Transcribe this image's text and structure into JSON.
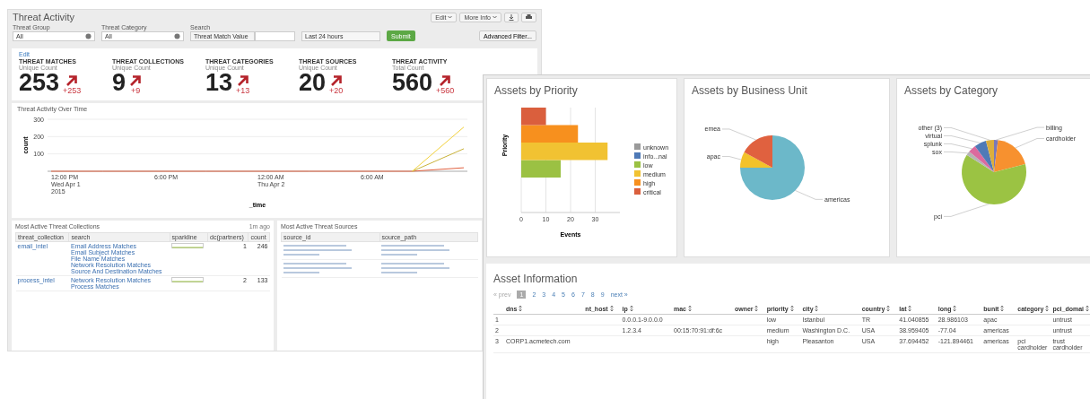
{
  "back_window": {
    "title": "Threat Activity",
    "header_buttons": [
      "Edit",
      "More Info"
    ],
    "filters": [
      {
        "label": "Threat Group",
        "value": "All"
      },
      {
        "label": "Threat Category",
        "value": "All"
      }
    ],
    "search": {
      "label": "Search",
      "field_type": "Threat Match Value"
    },
    "time_range": "Last 24 hours",
    "submit": "Submit",
    "advanced": "Advanced Filter...",
    "kpi_edit": "Edit",
    "kpis": [
      {
        "title": "THREAT MATCHES",
        "subtitle": "Unique Count",
        "value": "253",
        "delta": "+253"
      },
      {
        "title": "THREAT COLLECTIONS",
        "subtitle": "Unique Count",
        "value": "9",
        "delta": "+9"
      },
      {
        "title": "THREAT CATEGORIES",
        "subtitle": "Unique Count",
        "value": "13",
        "delta": "+13"
      },
      {
        "title": "THREAT SOURCES",
        "subtitle": "Unique Count",
        "value": "20",
        "delta": "+20"
      },
      {
        "title": "THREAT ACTIVITY",
        "subtitle": "Total Count",
        "value": "560",
        "delta": "+560"
      }
    ],
    "activity_chart": {
      "title": "Threat Activity Over Time",
      "chart_data": {
        "type": "line",
        "xlabel": "_time",
        "ylabel": "count",
        "categories": [
          "12:00 PM\nWed Apr 1\n2015",
          null,
          "6:00 PM",
          null,
          "12:00 AM\nThu Apr 2",
          null,
          "6:00 AM",
          null,
          null
        ],
        "ylim": [
          0,
          300
        ],
        "yticks": [
          100,
          200,
          300
        ],
        "series": [
          {
            "color": "#f2d13c",
            "values": [
              null,
              null,
              null,
              null,
              null,
              null,
              null,
              0,
              255
            ]
          },
          {
            "color": "#c9b23a",
            "values": [
              null,
              null,
              null,
              null,
              null,
              null,
              null,
              0,
              130
            ]
          },
          {
            "color": "#e0603f",
            "values": [
              0,
              0,
              0,
              0,
              0,
              0,
              0,
              0,
              20
            ]
          }
        ]
      }
    },
    "collections": {
      "title": "Most Active Threat Collections",
      "updated": "1m ago",
      "columns": [
        "threat_collection",
        "search",
        "sparkline",
        "dc(partners)",
        "count"
      ],
      "rows": [
        {
          "threat_collection": "email_intel",
          "searches": [
            "Email Address Matches",
            "Email Subject Matches",
            "File Name Matches",
            "Network Resolution Matches",
            "Source And Destination Matches"
          ],
          "partners": "1",
          "count": "246"
        },
        {
          "threat_collection": "process_intel",
          "searches": [
            "Network Resolution Matches",
            "Process Matches"
          ],
          "partners": "2",
          "count": "133"
        }
      ]
    },
    "sources": {
      "title": "Most Active Threat Sources",
      "columns": [
        "source_id",
        "source_path"
      ],
      "rows": [
        {
          "kind": "blurred"
        },
        {
          "kind": "blurred"
        }
      ]
    }
  },
  "front_window": {
    "priority_panel": {
      "title": "Assets by Priority",
      "chart_data": {
        "type": "bar",
        "orientation": "horizontal",
        "stacked": true,
        "grid": true,
        "legend": true,
        "xlabel": "Events",
        "ylabel": "Priority",
        "xlim": [
          0,
          40
        ],
        "xticks": [
          0,
          10,
          20,
          30
        ],
        "series": [
          {
            "name": "unknown",
            "color": "#9a9a9a",
            "values": [
              null,
              null,
              null,
              null,
              null,
              null
            ]
          },
          {
            "name": "info...nal",
            "color": "#4f7ab7",
            "values": [
              null,
              null,
              null,
              null,
              null,
              null
            ]
          },
          {
            "name": "low",
            "color": "#9bc143",
            "values": [
              null,
              null,
              null,
              16,
              null,
              null
            ]
          },
          {
            "name": "medium",
            "color": "#f1c232",
            "values": [
              null,
              null,
              35,
              null,
              null,
              null
            ]
          },
          {
            "name": "high",
            "color": "#f7901e",
            "values": [
              null,
              23,
              null,
              null,
              null,
              null
            ]
          },
          {
            "name": "critical",
            "color": "#da5f3d",
            "values": [
              10,
              null,
              null,
              null,
              null,
              null
            ]
          }
        ]
      }
    },
    "bunit_panel": {
      "title": "Assets by Business Unit",
      "chart_data": {
        "type": "pie",
        "categories": [
          "americas",
          "apac",
          "emea"
        ],
        "series": [
          {
            "values": [
              75,
              8,
              17
            ]
          }
        ],
        "colors": [
          "#6cb8c9",
          "#f3c22a",
          "#e0613f"
        ]
      }
    },
    "category_panel": {
      "title": "Assets by Category",
      "chart_data": {
        "type": "pie",
        "categories": [
          "billing",
          "cardholder",
          "pci",
          "sox",
          "splunk",
          "virtual",
          "other (3)"
        ],
        "series": [
          {
            "values": [
              2,
              19,
              63,
              2,
              4,
              6,
              4
            ]
          }
        ],
        "colors": [
          "#7b78b7",
          "#f7912f",
          "#9bc343",
          "#b5b5b5",
          "#db6a9e",
          "#4f7ab7",
          "#dcae3c"
        ]
      }
    },
    "asset_table": {
      "title": "Asset Information",
      "pager": {
        "prev": "« prev",
        "pages": [
          {
            "label": "1",
            "selected": true
          },
          {
            "label": "2",
            "selected": false
          },
          {
            "label": "3",
            "selected": false
          },
          {
            "label": "4",
            "selected": false
          },
          {
            "label": "5",
            "selected": false
          },
          {
            "label": "6",
            "selected": false
          },
          {
            "label": "7",
            "selected": false
          },
          {
            "label": "8",
            "selected": false
          },
          {
            "label": "9",
            "selected": false
          }
        ],
        "next": "next »"
      },
      "columns": [
        "dns",
        "nt_host",
        "ip",
        "mac",
        "owner",
        "priority",
        "city",
        "country",
        "lat",
        "long",
        "bunit",
        "category",
        "pci_domai"
      ],
      "rows": [
        {
          "index": "1",
          "ip": "0.0.0.1-9.0.0.0",
          "priority": "low",
          "city": "Istanbul",
          "country": "TR",
          "lat": "41.040855",
          "long": "28.986103",
          "bunit": "apac",
          "pci_domain": "untrust"
        },
        {
          "index": "2",
          "ip": "1.2.3.4",
          "mac": "00:15:70:91:df:6c",
          "priority": "medium",
          "city": "Washington D.C.",
          "country": "USA",
          "lat": "38.959405",
          "long": "-77.04",
          "bunit": "americas",
          "pci_domain": "untrust"
        },
        {
          "index": "3",
          "dns": "CORP1.acmetech.com",
          "priority": "high",
          "city": "Pleasanton",
          "country": "USA",
          "lat": "37.694452",
          "long": "-121.894461",
          "bunit": "americas",
          "category": "pci cardholder",
          "pci_domain": "trust cardholder"
        }
      ]
    }
  }
}
